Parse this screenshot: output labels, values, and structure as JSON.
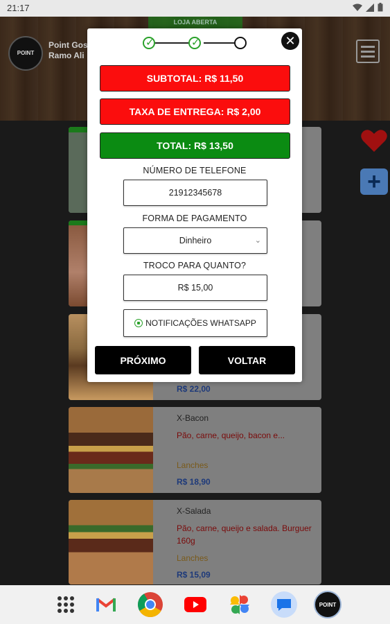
{
  "status_bar": {
    "time": "21:17"
  },
  "header": {
    "logo_text": "POINT",
    "store_name_line1": "Point Gos",
    "store_name_line2": "Ramo Ali",
    "open_badge": "LOJA ABERTA"
  },
  "products": [
    {
      "name": "",
      "description": "",
      "category": "",
      "price": "R$ 22,00"
    },
    {
      "name": "X-Bacon",
      "description": "Pão, carne, queijo, bacon e...",
      "category": "Lanches",
      "price": "R$ 18,90"
    },
    {
      "name": "X-Salada",
      "description": "Pão, carne, queijo e salada. Burguer 160g",
      "category": "Lanches",
      "price": "R$ 15,09"
    }
  ],
  "modal": {
    "subtotal": "SUBTOTAL: R$ 11,50",
    "delivery_fee": "TAXA DE ENTREGA: R$ 2,00",
    "total": "TOTAL: R$ 13,50",
    "phone_label": "NÚMERO DE TELEFONE",
    "phone_value": "21912345678",
    "payment_label": "FORMA DE PAGAMENTO",
    "payment_value": "Dinheiro",
    "change_label": "TROCO PARA QUANTO?",
    "change_value": "R$ 15,00",
    "whatsapp_label": "NOTIFICAÇÕES WHATSAPP",
    "next_label": "PRÓXIMO",
    "back_label": "VOLTAR",
    "close_symbol": "✕"
  },
  "colors": {
    "red": "#fb0d0d",
    "green": "#0b8b12",
    "black": "#000000"
  },
  "dock": {
    "apps": [
      "apps-grid-icon",
      "gmail-icon",
      "chrome-icon",
      "youtube-icon",
      "photos-icon",
      "messages-icon",
      "point-app-icon"
    ],
    "point_app_label": "POINT"
  }
}
